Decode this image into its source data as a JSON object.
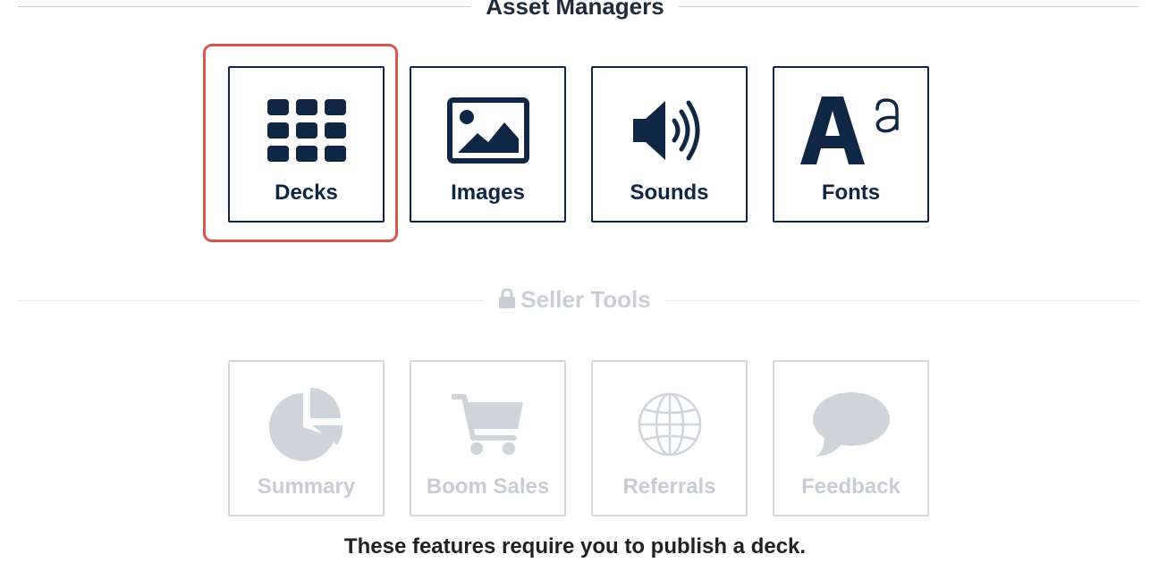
{
  "asset_managers": {
    "title": "Asset Managers",
    "tiles": [
      {
        "label": "Decks",
        "icon": "grid-icon"
      },
      {
        "label": "Images",
        "icon": "image-icon"
      },
      {
        "label": "Sounds",
        "icon": "volume-icon"
      },
      {
        "label": "Fonts",
        "icon": "font-icon"
      }
    ]
  },
  "seller_tools": {
    "title": "Seller Tools",
    "icon": "lock-icon",
    "tiles": [
      {
        "label": "Summary",
        "icon": "pie-chart-icon"
      },
      {
        "label": "Boom Sales",
        "icon": "shopping-cart-icon"
      },
      {
        "label": "Referrals",
        "icon": "globe-icon"
      },
      {
        "label": "Feedback",
        "icon": "speech-bubble-icon"
      }
    ],
    "note": "These features require you to publish a deck."
  },
  "colors": {
    "primary": "#0f2745",
    "disabled": "#c7ccd4",
    "highlight": "#dc5544"
  }
}
